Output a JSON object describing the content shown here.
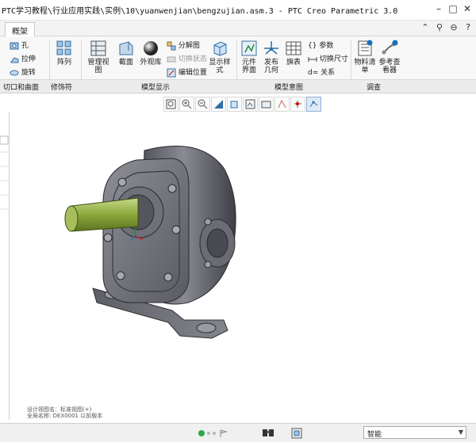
{
  "window": {
    "title": "PTC学习教程\\行业应用实践\\实例\\10\\yuanwenjian\\bengzujian.asm.3 - PTC Creo Parametric 3.0",
    "minimize": "–",
    "maximize": "□",
    "close": "✕"
  },
  "tabs": [
    {
      "label": "概架"
    }
  ],
  "tab_icons": [
    "⌃",
    "⚲",
    "⊖",
    "?"
  ],
  "ribbon": {
    "engineering": {
      "hole": "孔",
      "extrude": "拉伸",
      "revolve": "旋转"
    },
    "pattern": "阵列",
    "manage_views": "管理视图",
    "section": "截面",
    "appearance": "外观库",
    "explode": "分解图",
    "toggle_state": "切换状态",
    "edit_position": "编辑位置",
    "display_style": "显示样式",
    "component_interface": "元件界面",
    "publish_geometry": "发布几何",
    "flag": "旗表",
    "params": "参数",
    "toggle_dim": "切换尺寸",
    "relations": "关系",
    "bom": "物料清单",
    "reference_viewer": "参考查看器",
    "relations_prefix": "d="
  },
  "groups": {
    "cut_surface": "切口和曲面",
    "modifiers": "修饰符",
    "model_display": "模型显示",
    "model_intent": "模型意图",
    "investigate": "调查"
  },
  "canvas": {
    "status_line1": "设计视图名：标准视图(+)",
    "status_line2": "全局名称: DEX0001 以前版本"
  },
  "statusbar": {
    "select_filter": "智能"
  }
}
